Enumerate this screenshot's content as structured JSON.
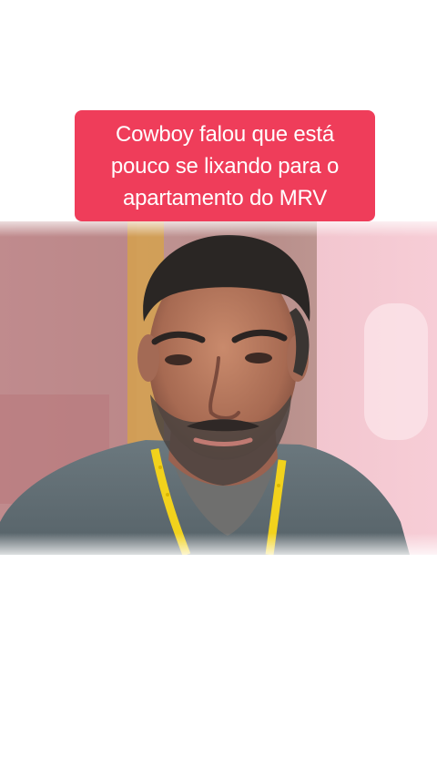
{
  "caption": {
    "text": "Cowboy falou que está pouco se lixando para o apartamento do MRV",
    "background": "#ef3d5a",
    "color": "#ffffff"
  },
  "video": {
    "subject": "man-with-beard-portrait",
    "lanyard_color": "#f2d21c",
    "shirt_color": "#5d6b72"
  }
}
